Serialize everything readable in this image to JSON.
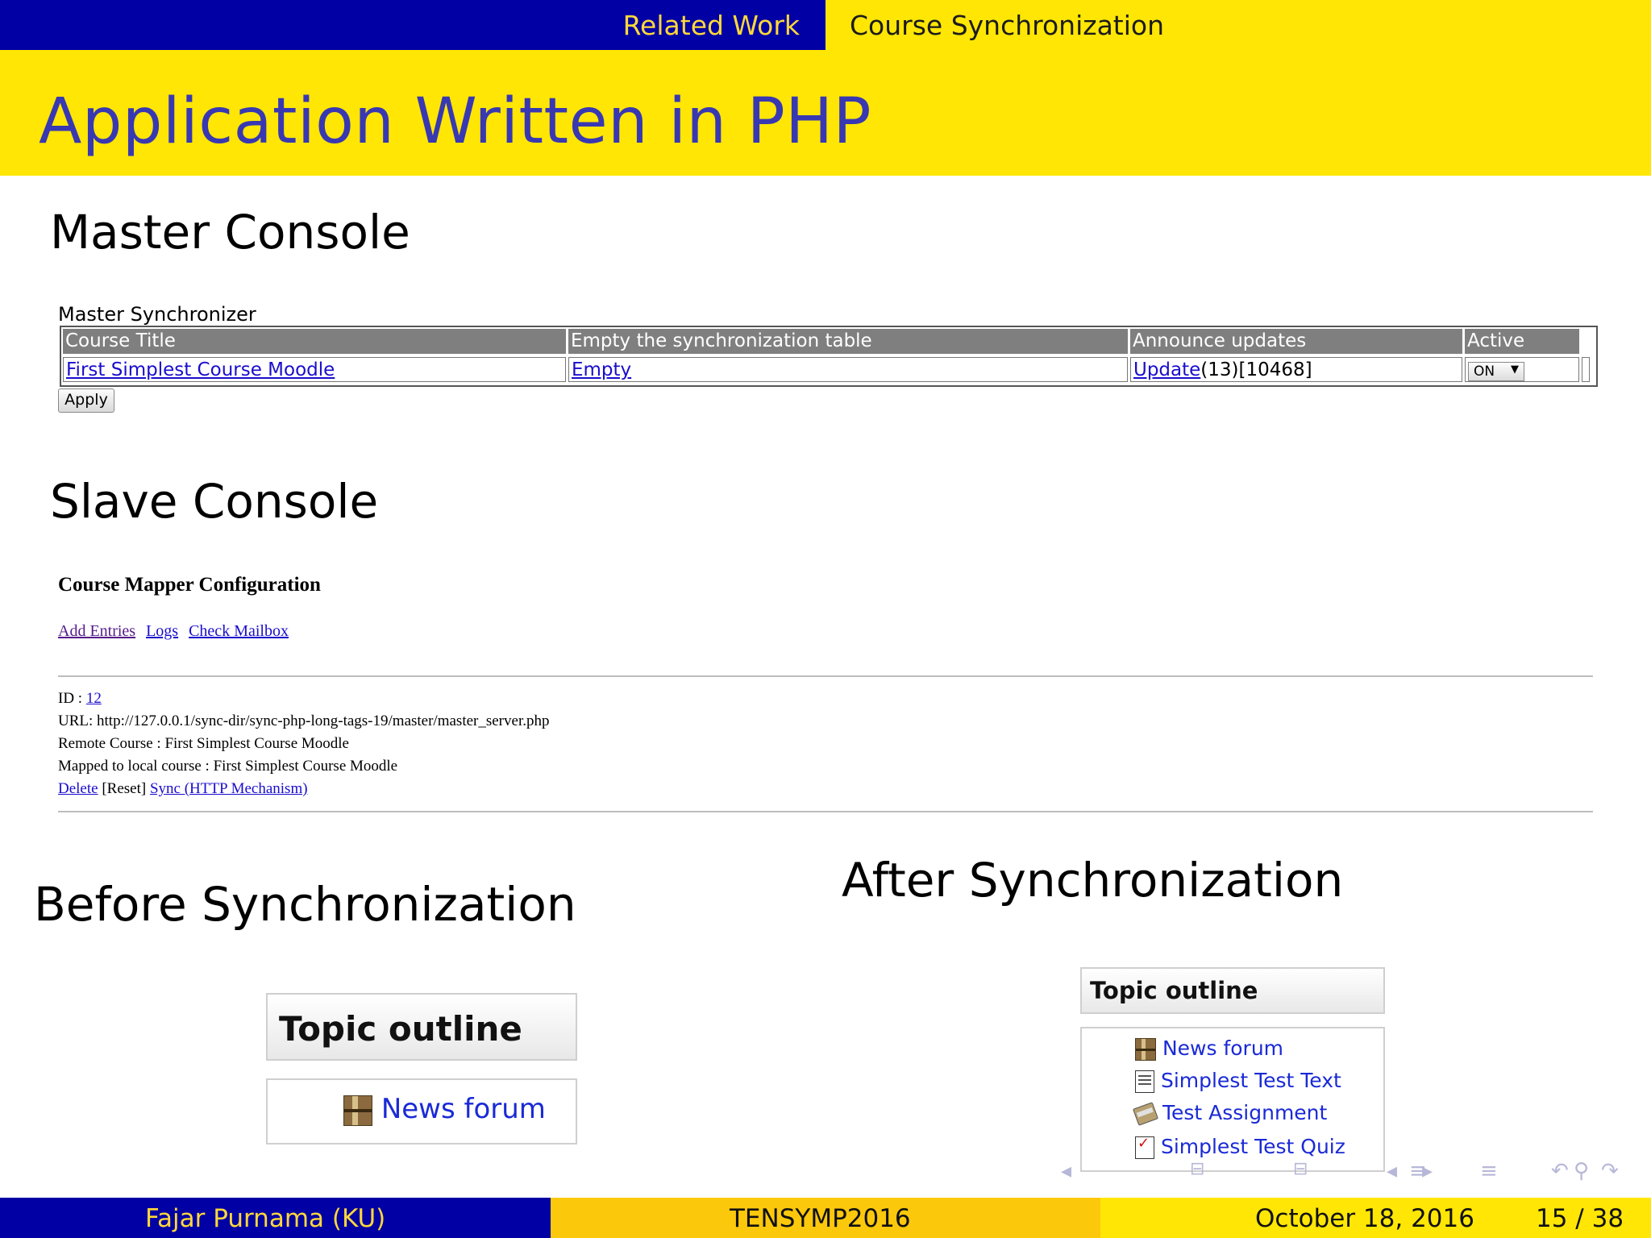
{
  "nav": {
    "section_related": "Related Work",
    "section_course": "Course Synchronization"
  },
  "frame_title": "Application Written in PHP",
  "master_console": {
    "heading": "Master Console",
    "caption": "Master Synchronizer",
    "columns": [
      "Course Title",
      "Empty the synchronization table",
      "Announce updates",
      "Active"
    ],
    "row": {
      "course_title": "First Simplest Course Moodle",
      "empty_link": "Empty",
      "update_link": "Update",
      "update_counts": "(13)[10468]",
      "active_value": "ON"
    },
    "apply_button": "Apply"
  },
  "slave_console": {
    "heading": "Slave Console",
    "title": "Course Mapper Configuration",
    "links": [
      "Add Entries",
      "Logs",
      "Check Mailbox"
    ],
    "id_label": "ID : ",
    "id_value": "12",
    "url_line": "URL: http://127.0.0.1/sync-dir/sync-php-long-tags-19/master/master_server.php",
    "remote_course": "Remote Course : First Simplest Course Moodle",
    "mapped_course": "Mapped to local course : First Simplest Course Moodle",
    "delete_link": "Delete",
    "reset_text": " [Reset] ",
    "sync_link": "Sync (HTTP Mechanism)"
  },
  "before": {
    "heading": "Before Synchronization",
    "outline_title": "Topic outline",
    "items": [
      {
        "label": "News forum",
        "icon": "forum-icon"
      }
    ]
  },
  "after": {
    "heading": "After Synchronization",
    "outline_title": "Topic outline",
    "items": [
      {
        "label": "News forum",
        "icon": "forum-icon"
      },
      {
        "label": "Simplest Test Text",
        "icon": "text-icon"
      },
      {
        "label": "Test Assignment",
        "icon": "assign-icon"
      },
      {
        "label": "Simplest Test Quiz",
        "icon": "quiz-icon"
      }
    ]
  },
  "footer": {
    "author": "Fajar Purnama  (KU)",
    "event": "TENSYMP2016",
    "date": "October 18, 2016",
    "page": "15 / 38"
  },
  "colors": {
    "nav_blue": "#0000a4",
    "beamer_yellow": "#ffe605",
    "title_blue": "#3838b2",
    "footer_orange": "#fcc80c"
  }
}
